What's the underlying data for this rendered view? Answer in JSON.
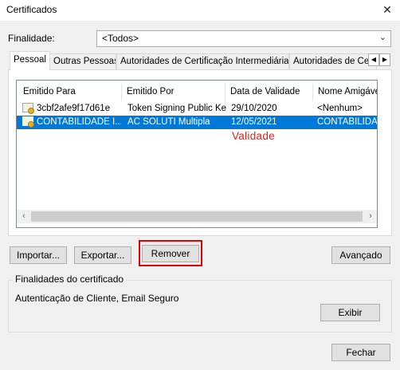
{
  "window": {
    "title": "Certificados",
    "close_symbol": "✕"
  },
  "purpose": {
    "label": "Finalidade:",
    "value": "<Todos>"
  },
  "tabs": [
    {
      "label": "Pessoal"
    },
    {
      "label": "Outras Pessoas"
    },
    {
      "label": "Autoridades de Certificação Intermediárias"
    },
    {
      "label": "Autoridades de Ce"
    }
  ],
  "table": {
    "columns": [
      "Emitido Para",
      "Emitido Por",
      "Data de Validade",
      "Nome Amigável"
    ],
    "rows": [
      {
        "issued_to": "3cbf2afe9f17d61e",
        "issued_by": "Token Signing Public Key",
        "expiry": "29/10/2020",
        "friendly": "<Nenhum>",
        "selected": false
      },
      {
        "issued_to": "CONTABILIDADE I...",
        "issued_by": "AC SOLUTI Multipla",
        "expiry": "12/05/2021",
        "friendly": "CONTABILIDADE",
        "selected": true
      }
    ],
    "annotation": "Validade"
  },
  "buttons": {
    "import": "Importar...",
    "export": "Exportar...",
    "remove": "Remover",
    "advanced": "Avançado",
    "view": "Exibir",
    "close": "Fechar"
  },
  "cert_purposes": {
    "title": "Finalidades do certificado",
    "value": "Autenticação de Cliente, Email Seguro"
  },
  "colors": {
    "selection": "#0078d7",
    "annotation": "#e0201a",
    "highlight_box": "#e00000"
  }
}
